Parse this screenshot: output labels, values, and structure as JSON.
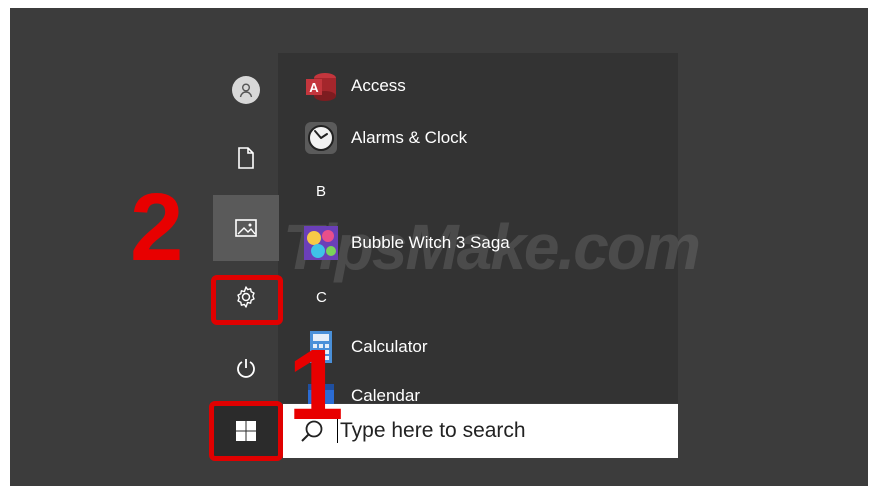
{
  "watermark_text": "TipsMake.com",
  "annotations": {
    "step1": "1",
    "step2": "2",
    "highlight_color": "#e00000"
  },
  "rail": {
    "icons": [
      "user-icon",
      "documents-icon",
      "pictures-icon",
      "settings-icon",
      "power-icon"
    ]
  },
  "apps": [
    {
      "label": "Access",
      "icon": "access-icon",
      "color": "#a4262c"
    },
    {
      "label": "Alarms & Clock",
      "icon": "alarm-clock-icon",
      "color": "#f0f0f0"
    },
    {
      "label": "Bubble Witch 3 Saga",
      "icon": "bubble-witch-icon",
      "color": "#6b3fb8"
    },
    {
      "label": "Calculator",
      "icon": "calculator-icon",
      "color": "#4a90d9"
    },
    {
      "label": "Calendar",
      "icon": "calendar-icon",
      "color": "#2b6cd4"
    }
  ],
  "section_letters": {
    "b": "B",
    "c": "C"
  },
  "taskbar": {
    "start_icon": "windows-logo-icon",
    "search_placeholder": "Type here to search",
    "search_icon": "search-icon"
  },
  "colors": {
    "screen_bg": "#3c3c3c",
    "list_bg": "#333333",
    "search_bg": "#ffffff"
  }
}
